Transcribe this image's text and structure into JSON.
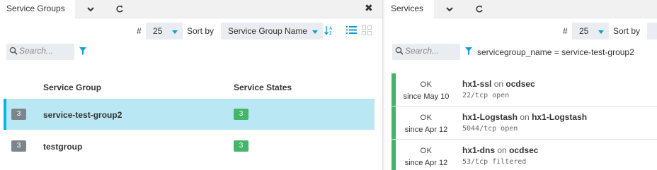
{
  "left": {
    "tab_title": "Service Groups",
    "limit_prefix": "#",
    "limit_value": "25",
    "sort_label": "Sort by",
    "sort_value": "Service Group Name",
    "search_placeholder": "Search...",
    "columns": [
      "Service Group",
      "Service States"
    ],
    "rows": [
      {
        "count": "3",
        "name": "service-test-group2",
        "ok": "3",
        "selected": true
      },
      {
        "count": "3",
        "name": "testgroup",
        "ok": "3",
        "selected": false
      }
    ]
  },
  "right": {
    "tab_title": "Services",
    "limit_prefix": "#",
    "limit_value": "25",
    "sort_label": "Sort by",
    "search_placeholder": "Search...",
    "filter_text": "servicegroup_name = service-test-group2",
    "services": [
      {
        "state": "OK",
        "since": "since May 10",
        "service": "hx1-ssl",
        "on": "on",
        "host": "ocdsec",
        "output": "22/tcp open"
      },
      {
        "state": "OK",
        "since": "since Apr 12",
        "service": "hx1-Logstash",
        "on": "on",
        "host": "hx1-Logstash",
        "output": "5044/tcp open"
      },
      {
        "state": "OK",
        "since": "since Apr 12",
        "service": "hx1-dns",
        "on": "on",
        "host": "ocdsec",
        "output": "53/tcp filtered"
      }
    ]
  },
  "colors": {
    "ok": "#45b56c",
    "accent": "#0ab5e0",
    "selected_row": "#b9e7f4",
    "neutral_badge": "#7d858c"
  }
}
